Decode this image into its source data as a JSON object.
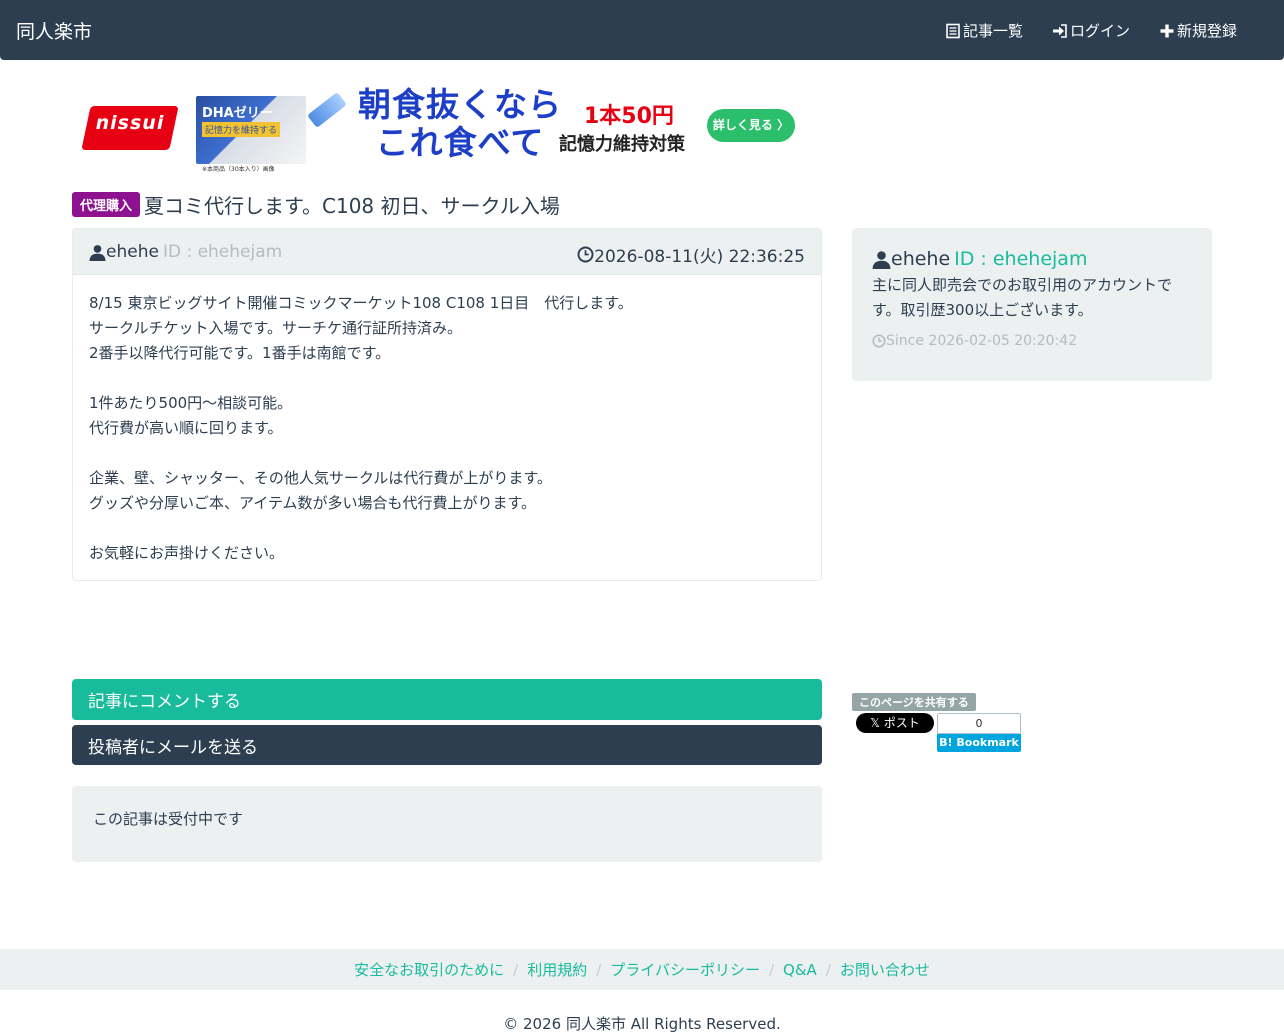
{
  "nav": {
    "brand": "同人楽市",
    "items": [
      {
        "label": "記事一覧",
        "icon": "list-icon"
      },
      {
        "label": "ログイン",
        "icon": "login-icon"
      },
      {
        "label": "新規登録",
        "icon": "plus-icon"
      }
    ]
  },
  "ad": {
    "logo": "nissui",
    "product_name": "DHAゼリー",
    "product_tag": "記憶力を維持する",
    "product_note": "※本商品（30本入り）画像",
    "headline_1": "朝食抜くなら",
    "headline_2": "これ食べて",
    "price": "1本50円",
    "sub": "記憶力維持対策",
    "cta": "詳しく見る 〉"
  },
  "post": {
    "category": "代理購入",
    "title": "夏コミ代行します。C108 初日、サークル入場",
    "author": "ehehe",
    "author_id": "ID : ehehejam",
    "date": "2026-08-11(火) 22:36:25",
    "body": [
      "8/15 東京ビッグサイト開催コミックマーケット108 C108 1日目　代行します。",
      "サークルチケット入場です。サーチケ通行証所持済み。",
      "2番手以降代行可能です。1番手は南館です。",
      "",
      "1件あたり500円〜相談可能。",
      "代行費が高い順に回ります。",
      "",
      "企業、壁、シャッター、その他人気サークルは代行費が上がります。",
      "グッズや分厚いご本、アイテム数が多い場合も代行費上がります。",
      "",
      "お気軽にお声掛けください。"
    ]
  },
  "profile": {
    "name": "ehehe",
    "id": "ID : ehehejam",
    "desc": "主に同人即売会でのお取引用のアカウントです。取引歴300以上ございます。",
    "since": "Since 2026-02-05 20:20:42"
  },
  "actions": {
    "comment": "記事にコメントする",
    "mail": "投稿者にメールを送る",
    "status": "この記事は受付中です"
  },
  "share": {
    "label": "このページを共有する",
    "x_post": "ポスト",
    "hatena_count": "0",
    "hatena_label": "Bookmark"
  },
  "footer": {
    "links": [
      "安全なお取引のために",
      "利用規約",
      "プライバシーポリシー",
      "Q&A",
      "お問い合わせ"
    ],
    "copyright": "© 2026 同人楽市 All Rights Reserved."
  },
  "colors": {
    "navbar": "#2c3e50",
    "accent": "#18bc9c",
    "category_badge": "#8e1190",
    "panel": "#ecf0f1"
  }
}
